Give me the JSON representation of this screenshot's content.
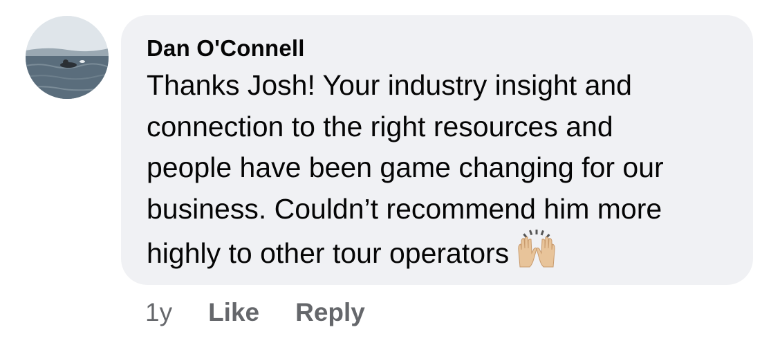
{
  "comment": {
    "author": "Dan O'Connell",
    "text_lines": [
      "Thanks Josh! Your industry insight and",
      "connection to the right resources and",
      "people have been game changing for our",
      "business. Couldn’t recommend him more",
      "highly to other tour operators"
    ],
    "emoji": "raising-hands-emoji",
    "avatar_icon": "profile-photo-surfer"
  },
  "actions": {
    "time": "1y",
    "like_label": "Like",
    "reply_label": "Reply"
  }
}
